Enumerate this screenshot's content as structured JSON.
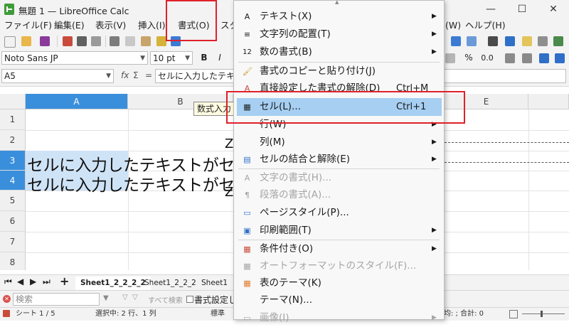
{
  "window": {
    "title": "無題 1 — LibreOffice Calc",
    "minimize": "—",
    "maximize": "☐",
    "close": "✕"
  },
  "menubar": [
    "ファイル(F)",
    "編集(E)",
    "表示(V)",
    "挿入(I)",
    "書式(O)",
    "スタ",
    "(W)",
    "ヘルプ(H)"
  ],
  "toolbar": {
    "font_name": "Noto Sans JP",
    "font_size": "10 pt",
    "bold": "B",
    "italic": "I",
    "percent": "%",
    "decimal": "0.0"
  },
  "formula_bar": {
    "name_box": "A5",
    "fx": "fx",
    "sigma": "Σ",
    "equals": "=",
    "content": "セルに入力したテキス"
  },
  "grid": {
    "columns": [
      "A",
      "B",
      "E"
    ],
    "rows": [
      "1",
      "2",
      "3",
      "4",
      "5",
      "6",
      "7",
      "8"
    ],
    "cells": {
      "row3": "セルに入力したテキストがセ",
      "row4": "セルに入力したテキストがセ"
    },
    "overflow_chars": [
      "Z",
      "Z"
    ]
  },
  "tooltip": "数式入力",
  "sheet_tabs": {
    "nav": [
      "⏮",
      "◀",
      "▶",
      "⏭",
      "+"
    ],
    "tabs": [
      "Sheet1_2_2_2_2",
      "Sheet1_2_2_2",
      "Sheet1"
    ]
  },
  "find_bar": {
    "placeholder": "検索",
    "find_all": "すべて検索",
    "format_option": "書式設定し"
  },
  "status_bar": {
    "sheet": "シート 1 / 5",
    "selection": "選択中: 2 行、1 列",
    "style": "標準",
    "sum": "均: ; 合計: 0"
  },
  "context_menu": {
    "items": [
      {
        "icon": "A",
        "label": "テキスト(X)",
        "submenu": true,
        "disabled": false
      },
      {
        "icon": "≡",
        "label": "文字列の配置(T)",
        "submenu": true,
        "disabled": false
      },
      {
        "icon": "12",
        "label": "数の書式(B)",
        "submenu": true,
        "disabled": false
      },
      {
        "icon": "🖌",
        "label": "書式のコピーと貼り付け(J)",
        "submenu": false,
        "disabled": false
      },
      {
        "icon": "A",
        "label": "直接設定した書式の解除(D)",
        "shortcut": "Ctrl+M",
        "submenu": false,
        "disabled": false
      },
      {
        "icon": "▦",
        "label": "セル(L)...",
        "shortcut": "Ctrl+1",
        "submenu": false,
        "disabled": false,
        "highlight": true
      },
      {
        "icon": "",
        "label": "行(W)",
        "submenu": true,
        "disabled": false
      },
      {
        "icon": "",
        "label": "列(M)",
        "submenu": true,
        "disabled": false
      },
      {
        "icon": "▤",
        "label": "セルの結合と解除(E)",
        "submenu": true,
        "disabled": false
      },
      {
        "icon": "A",
        "label": "文字の書式(H)...",
        "submenu": false,
        "disabled": true
      },
      {
        "icon": "¶",
        "label": "段落の書式(A)...",
        "submenu": false,
        "disabled": true
      },
      {
        "icon": "▭",
        "label": "ページスタイル(P)...",
        "submenu": false,
        "disabled": false
      },
      {
        "icon": "▣",
        "label": "印刷範囲(T)",
        "submenu": true,
        "disabled": false
      },
      {
        "icon": "▦",
        "label": "条件付き(O)",
        "submenu": true,
        "disabled": false
      },
      {
        "icon": "▦",
        "label": "オートフォーマットのスタイル(F)...",
        "submenu": false,
        "disabled": true
      },
      {
        "icon": "▦",
        "label": "表のテーマ(K)",
        "submenu": false,
        "disabled": false
      },
      {
        "icon": "",
        "label": "テーマ(N)...",
        "submenu": false,
        "disabled": false
      },
      {
        "icon": "▭",
        "label": "画像(I)",
        "submenu": true,
        "disabled": true
      }
    ]
  },
  "colors": {
    "accent": "#3a8fdc",
    "selection": "#cfe3f7",
    "menu_highlight": "#a6cff2",
    "annotation": "#e0202a"
  }
}
